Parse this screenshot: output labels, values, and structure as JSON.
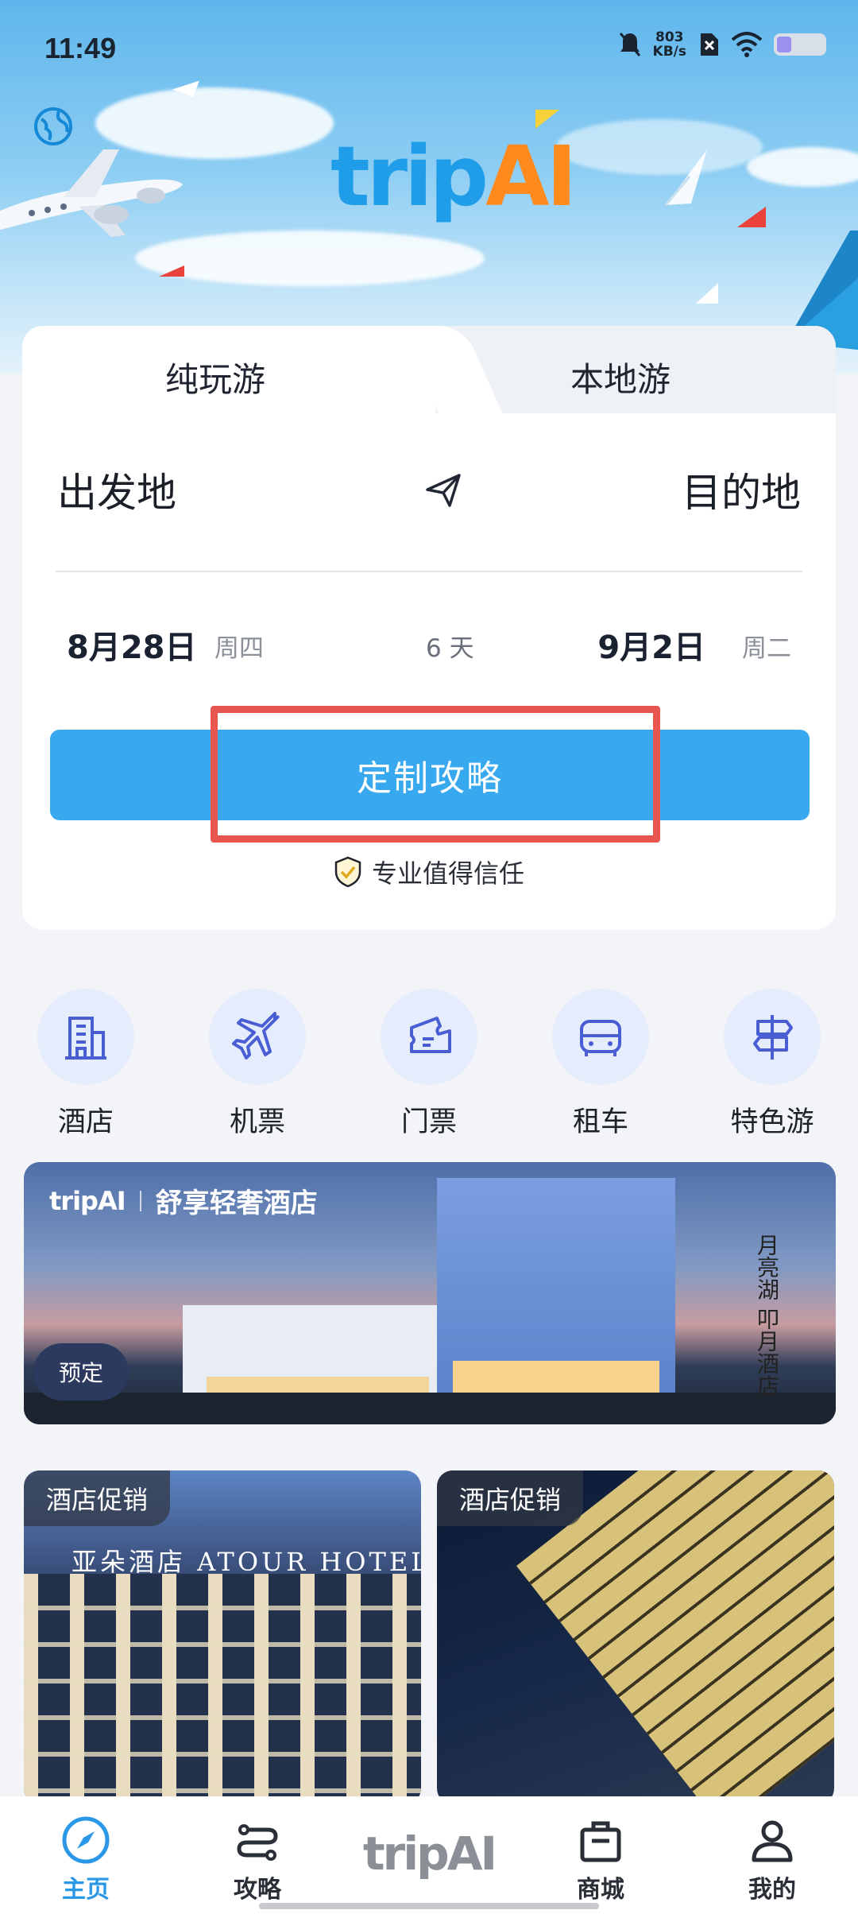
{
  "status_bar": {
    "time": "11:49",
    "net_speed_value": "803",
    "net_speed_unit": "KB/s"
  },
  "header": {
    "logo_part1": "trip",
    "logo_part2": "AI"
  },
  "search_card": {
    "tabs": [
      {
        "label": "纯玩游"
      },
      {
        "label": "本地游"
      }
    ],
    "departure": "出发地",
    "destination": "目的地",
    "start_date": "8月28日",
    "start_weekday": "周四",
    "duration": "6 天",
    "end_date": "9月2日",
    "end_weekday": "周二",
    "cta_label": "定制攻略",
    "trust_text": "专业值得信任"
  },
  "categories": [
    {
      "label": "酒店",
      "icon": "hotel-icon"
    },
    {
      "label": "机票",
      "icon": "airplane-icon"
    },
    {
      "label": "门票",
      "icon": "ticket-icon"
    },
    {
      "label": "租车",
      "icon": "car-icon"
    },
    {
      "label": "特色游",
      "icon": "signpost-icon"
    }
  ],
  "banner": {
    "brand": "tripAI",
    "title": "舒享轻奢酒店",
    "book_label": "预定",
    "calligraphy_1": "月亮湖",
    "calligraphy_2": "叩月酒店"
  },
  "hotel_cards": [
    {
      "badge": "酒店促销",
      "sign": "亚朵酒店 ATOUR HOTEL"
    },
    {
      "badge": "酒店促销"
    }
  ],
  "bottom_nav": {
    "items": [
      {
        "label": "主页",
        "icon": "compass-icon"
      },
      {
        "label": "攻略",
        "icon": "route-icon"
      },
      {
        "label": "tripAI",
        "icon": "logo"
      },
      {
        "label": "商城",
        "icon": "shopping-bag-icon"
      },
      {
        "label": "我的",
        "icon": "user-icon"
      }
    ]
  },
  "colors": {
    "accent": "#38a8ef",
    "logo_blue": "#1f9de8",
    "logo_orange": "#ff8a1e",
    "highlight_box": "#e7564f",
    "nav_active": "#2a98e6"
  }
}
